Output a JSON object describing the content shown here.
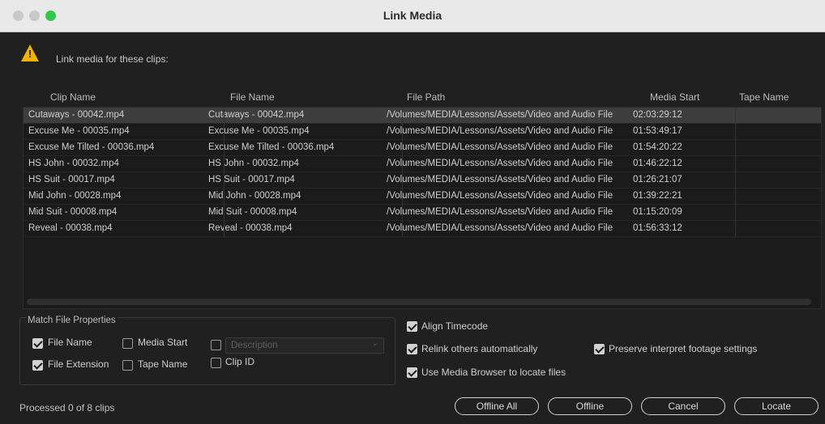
{
  "window": {
    "title": "Link Media"
  },
  "prompt": "Link media for these clips:",
  "table": {
    "columns": [
      "Clip Name",
      "File Name",
      "File Path",
      "Media Start",
      "Tape Name"
    ],
    "rows": [
      [
        "Cutaways - 00042.mp4",
        "Cutaways - 00042.mp4",
        "/Volumes/MEDIA/Lessons/Assets/Video and Audio File",
        "02:03:29:12",
        ""
      ],
      [
        "Excuse Me - 00035.mp4",
        "Excuse Me - 00035.mp4",
        "/Volumes/MEDIA/Lessons/Assets/Video and Audio File",
        "01:53:49:17",
        ""
      ],
      [
        "Excuse Me Tilted - 00036.mp4",
        "Excuse Me Tilted - 00036.mp4",
        "/Volumes/MEDIA/Lessons/Assets/Video and Audio File",
        "01:54:20:22",
        ""
      ],
      [
        "HS John - 00032.mp4",
        "HS John - 00032.mp4",
        "/Volumes/MEDIA/Lessons/Assets/Video and Audio File",
        "01:46:22:12",
        ""
      ],
      [
        "HS Suit - 00017.mp4",
        "HS Suit - 00017.mp4",
        "/Volumes/MEDIA/Lessons/Assets/Video and Audio File",
        "01:26:21:07",
        ""
      ],
      [
        "Mid John - 00028.mp4",
        "Mid John - 00028.mp4",
        "/Volumes/MEDIA/Lessons/Assets/Video and Audio File",
        "01:39:22:21",
        ""
      ],
      [
        "Mid Suit - 00008.mp4",
        "Mid Suit - 00008.mp4",
        "/Volumes/MEDIA/Lessons/Assets/Video and Audio File",
        "01:15:20:09",
        ""
      ],
      [
        "Reveal - 00038.mp4",
        "Reveal - 00038.mp4",
        "/Volumes/MEDIA/Lessons/Assets/Video and Audio File",
        "01:56:33:12",
        ""
      ]
    ]
  },
  "match": {
    "title": "Match File Properties",
    "file_name": {
      "label": "File Name",
      "checked": true
    },
    "media_start": {
      "label": "Media Start",
      "checked": false
    },
    "description": {
      "label": "Description",
      "checked": false
    },
    "file_extension": {
      "label": "File Extension",
      "checked": true
    },
    "tape_name": {
      "label": "Tape Name",
      "checked": false
    },
    "clip_id": {
      "label": "Clip ID",
      "checked": false
    }
  },
  "options": {
    "align_timecode": {
      "label": "Align Timecode",
      "checked": true
    },
    "relink_others": {
      "label": "Relink others automatically",
      "checked": true
    },
    "preserve_interpret": {
      "label": "Preserve interpret footage settings",
      "checked": true
    },
    "use_media_browser": {
      "label": "Use Media Browser to locate files",
      "checked": true
    }
  },
  "status": "Processed 0 of 8 clips",
  "buttons": {
    "offline_all": "Offline All",
    "offline": "Offline",
    "cancel": "Cancel",
    "locate": "Locate"
  },
  "icons": {
    "warning": "warning-icon",
    "checkmark": "checkmark-icon",
    "caret": "chevron-down-icon"
  },
  "colors": {
    "warning": "#f0b400",
    "maximize": "#34c84a",
    "selection": "#3d3d3d"
  }
}
